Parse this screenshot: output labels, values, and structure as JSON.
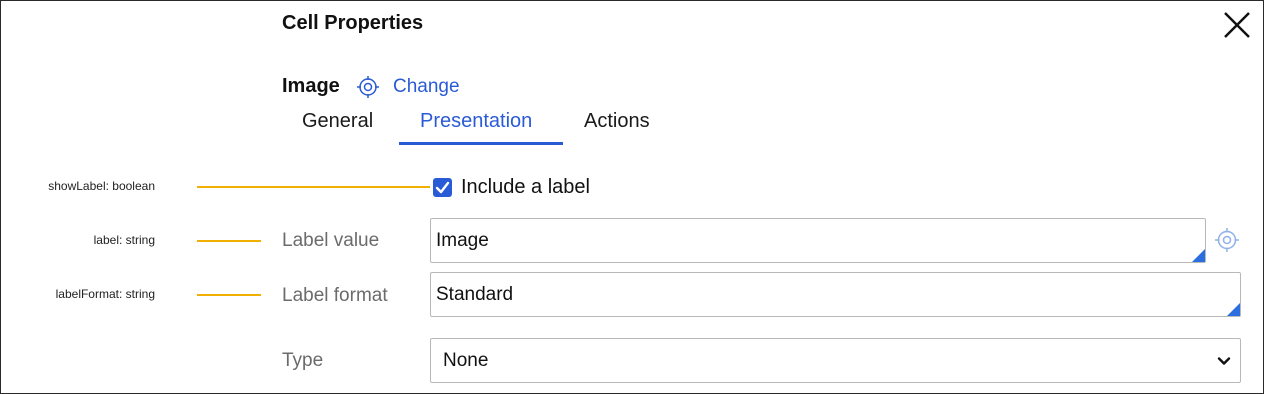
{
  "dialog": {
    "title": "Cell Properties",
    "close_icon": "close-icon"
  },
  "section": {
    "title": "Image",
    "target_icon": "target-icon",
    "change_label": "Change"
  },
  "tabs": [
    {
      "label": "General",
      "active": false
    },
    {
      "label": "Presentation",
      "active": true
    },
    {
      "label": "Actions",
      "active": false
    }
  ],
  "annotations": [
    {
      "text": "showLabel: boolean"
    },
    {
      "text": "label: string"
    },
    {
      "text": "labelFormat: string"
    }
  ],
  "form": {
    "include_label": {
      "label": "Include a label",
      "checked": true
    },
    "label_value": {
      "label": "Label value",
      "value": "Image"
    },
    "label_format": {
      "label": "Label format",
      "value": "Standard"
    },
    "type": {
      "label": "Type",
      "value": "None"
    }
  },
  "colors": {
    "accent": "#2a5bd7",
    "annotation_line": "#f0b000",
    "label_gray": "#6b6b6b"
  }
}
